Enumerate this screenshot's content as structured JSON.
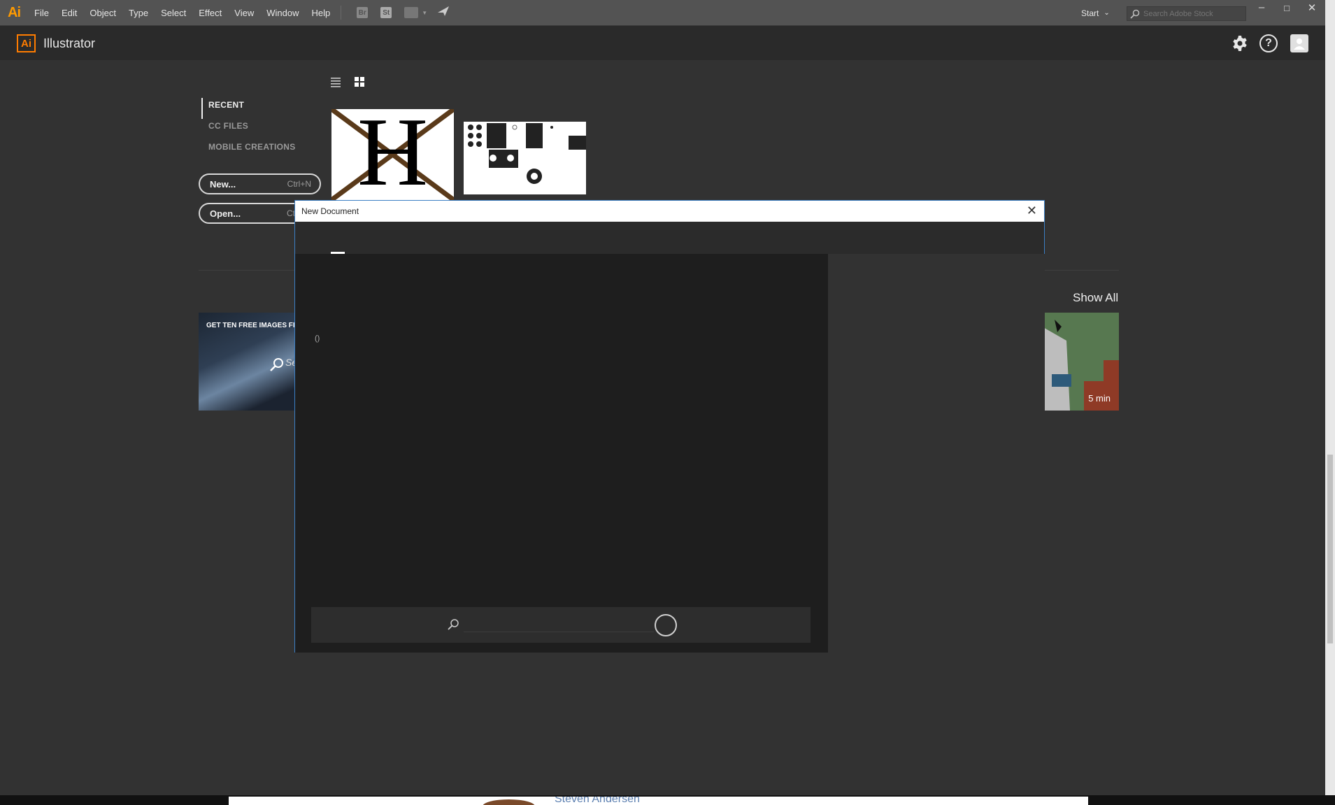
{
  "menubar": {
    "logo": "Ai",
    "items": [
      "File",
      "Edit",
      "Object",
      "Type",
      "Select",
      "Effect",
      "View",
      "Window",
      "Help"
    ],
    "toolbar_icons": [
      "Br",
      "St",
      "",
      ""
    ],
    "workspace": "Start",
    "search_placeholder": "Search Adobe Stock",
    "window_controls": [
      "–",
      "□",
      "✕"
    ]
  },
  "header": {
    "logo": "Ai",
    "app_name": "Illustrator",
    "help_glyph": "?"
  },
  "start": {
    "nav": [
      "RECENT",
      "CC FILES",
      "MOBILE CREATIONS"
    ],
    "new_button": {
      "label": "New...",
      "shortcut": "Ctrl+N"
    },
    "open_button": {
      "label": "Open...",
      "shortcut": "Ctrl+O"
    },
    "show_all": "Show All",
    "stock_card_caption": "GET TEN FREE IMAGES FROM",
    "stock_search_text": "Se",
    "tutorial_duration": "5 min",
    "recent_thumb_letter": "H"
  },
  "dialog": {
    "title": "New Document",
    "close": "✕",
    "count": "()",
    "search_placeholder": ""
  },
  "footer": {
    "name": "Steven Andersen"
  }
}
